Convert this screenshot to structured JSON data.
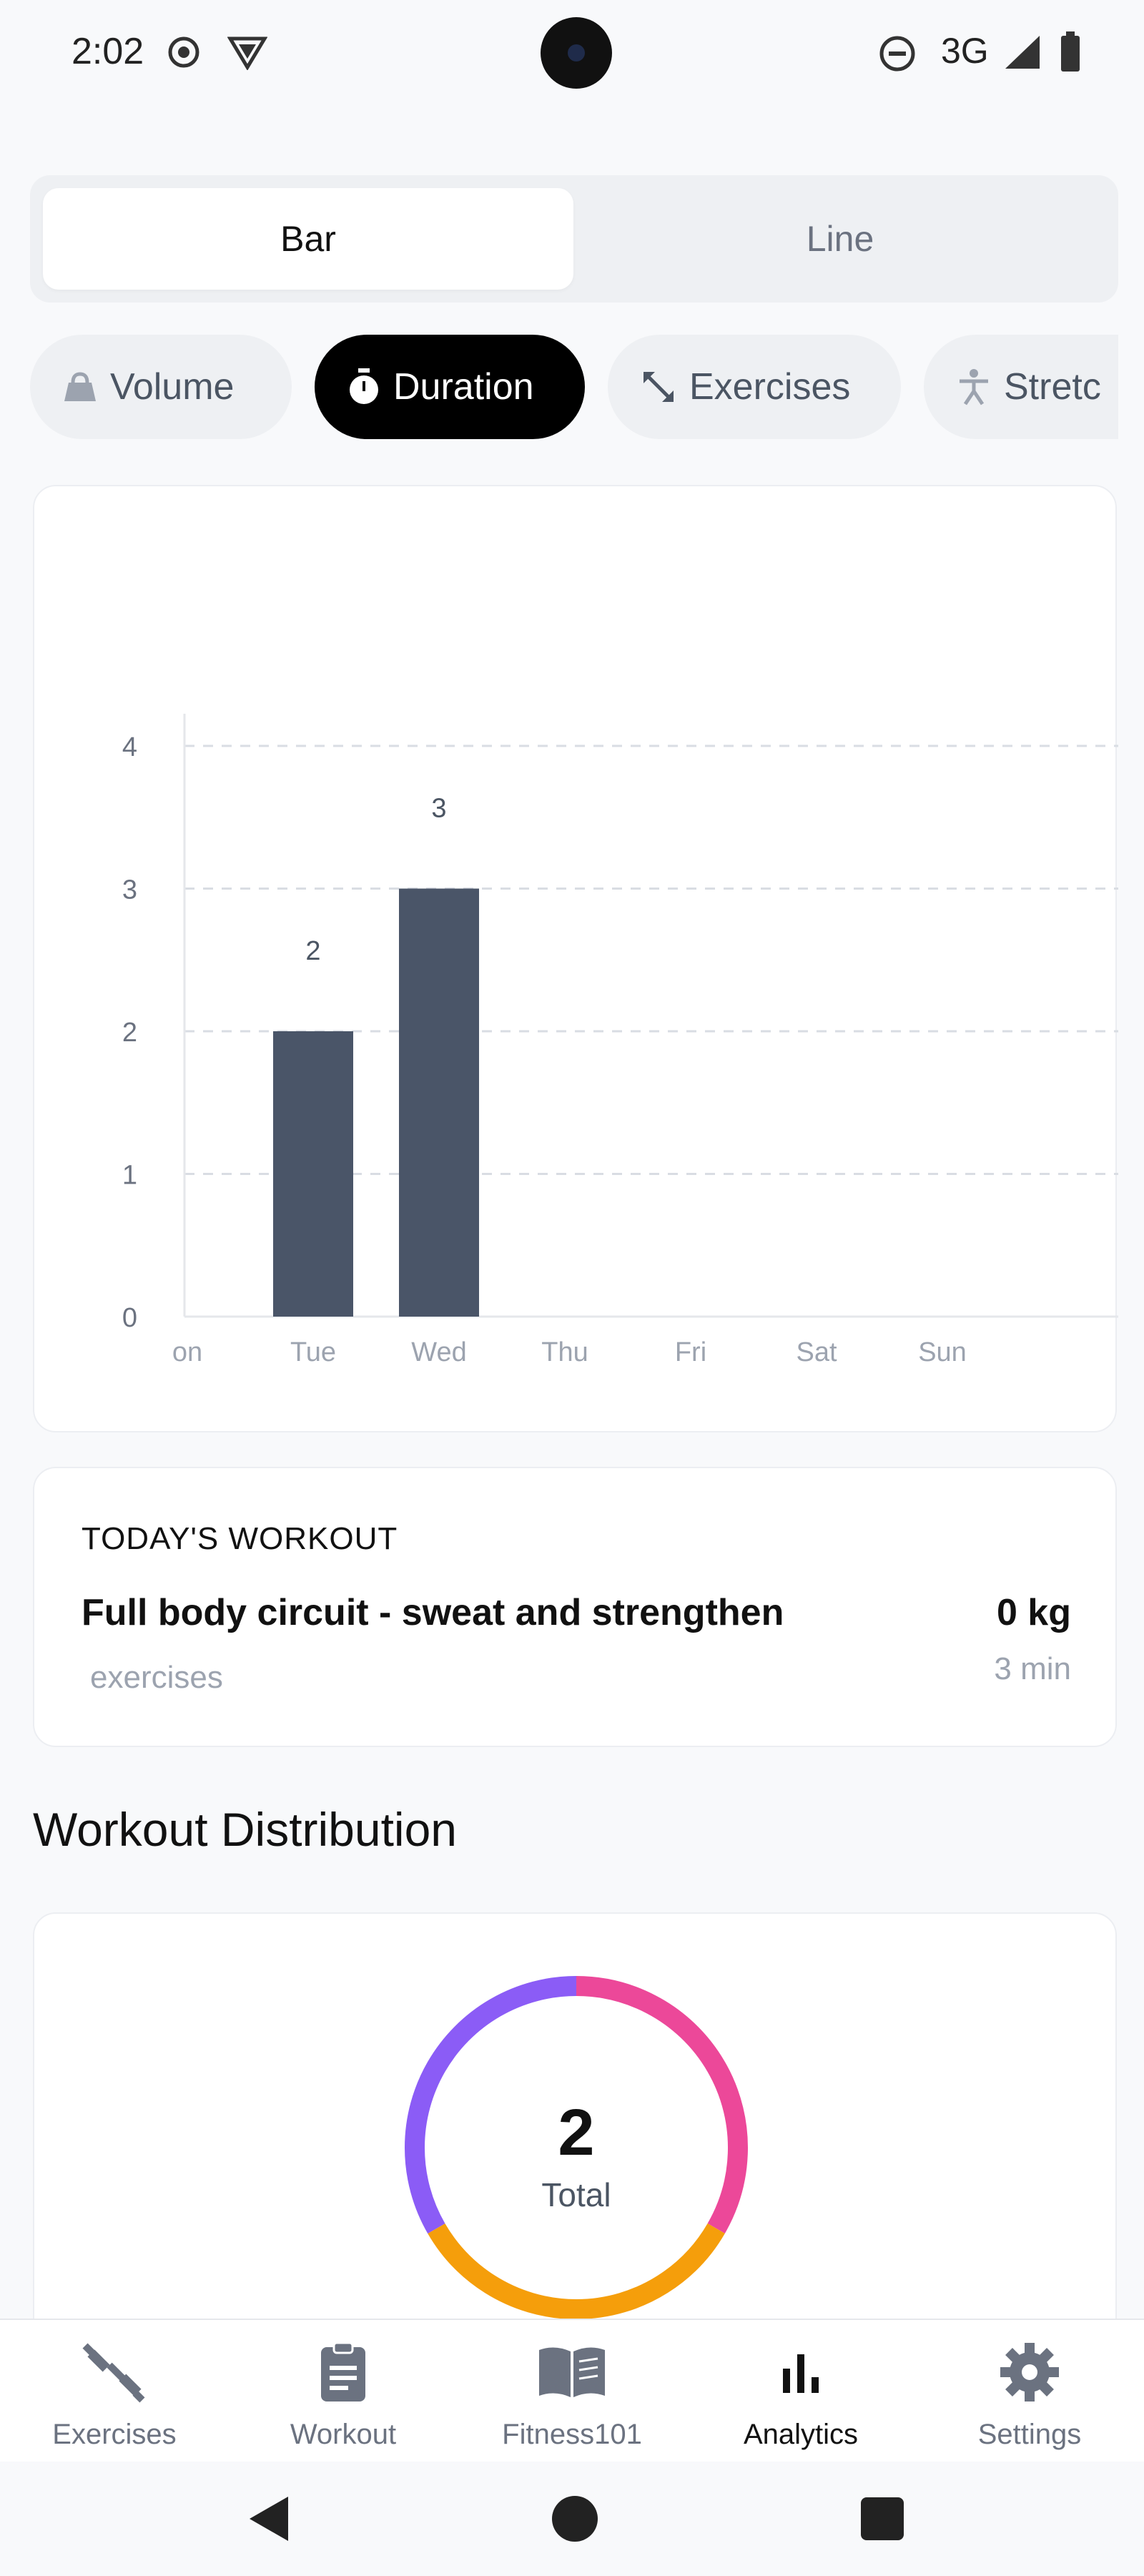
{
  "status_bar": {
    "time": "2:02",
    "network": "3G"
  },
  "view_toggle": {
    "options": [
      "Bar",
      "Line"
    ],
    "selected": "Bar"
  },
  "metric_chips": [
    {
      "label": "Volume",
      "icon": "weight-icon",
      "active": false
    },
    {
      "label": "Duration",
      "icon": "stopwatch-icon",
      "active": true
    },
    {
      "label": "Exercises",
      "icon": "resize-arrows-icon",
      "active": false
    },
    {
      "label": "Stretc",
      "icon": "stretch-figure-icon",
      "active": false
    }
  ],
  "chart_data": {
    "type": "bar",
    "categories": [
      "on",
      "Tue",
      "Wed",
      "Thu",
      "Fri",
      "Sat",
      "Sun"
    ],
    "values": [
      0,
      2,
      3,
      0,
      0,
      0,
      0
    ],
    "data_labels": [
      "",
      "2",
      "3",
      "",
      "",
      "",
      ""
    ],
    "y_ticks": [
      "0",
      "1",
      "2",
      "3",
      "4"
    ],
    "ylim": [
      0,
      4
    ],
    "grid": true,
    "bar_color": "#4a5568"
  },
  "todays_workout": {
    "heading": "TODAY'S WORKOUT",
    "name": "Full body circuit - sweat and strengthen",
    "subtitle": "exercises",
    "weight": "0 kg",
    "duration": "3 min"
  },
  "distribution": {
    "title": "Workout Distribution",
    "total": "2",
    "total_label": "Total",
    "segments": [
      {
        "color": "#ec4899",
        "fraction": 0.3333
      },
      {
        "color": "#f59e0b",
        "fraction": 0.3333
      },
      {
        "color": "#8b5cf6",
        "fraction": 0.3334
      }
    ]
  },
  "bottom_nav": {
    "items": [
      {
        "label": "Exercises",
        "icon": "dumbbell-icon"
      },
      {
        "label": "Workout",
        "icon": "clipboard-icon"
      },
      {
        "label": "Fitness101",
        "icon": "book-icon"
      },
      {
        "label": "Analytics",
        "icon": "bar-chart-icon"
      },
      {
        "label": "Settings",
        "icon": "gear-icon"
      }
    ],
    "active": "Analytics"
  },
  "colors": {
    "background": "#f8f9fb",
    "active_chip": "#000000",
    "bar": "#4a5568"
  }
}
